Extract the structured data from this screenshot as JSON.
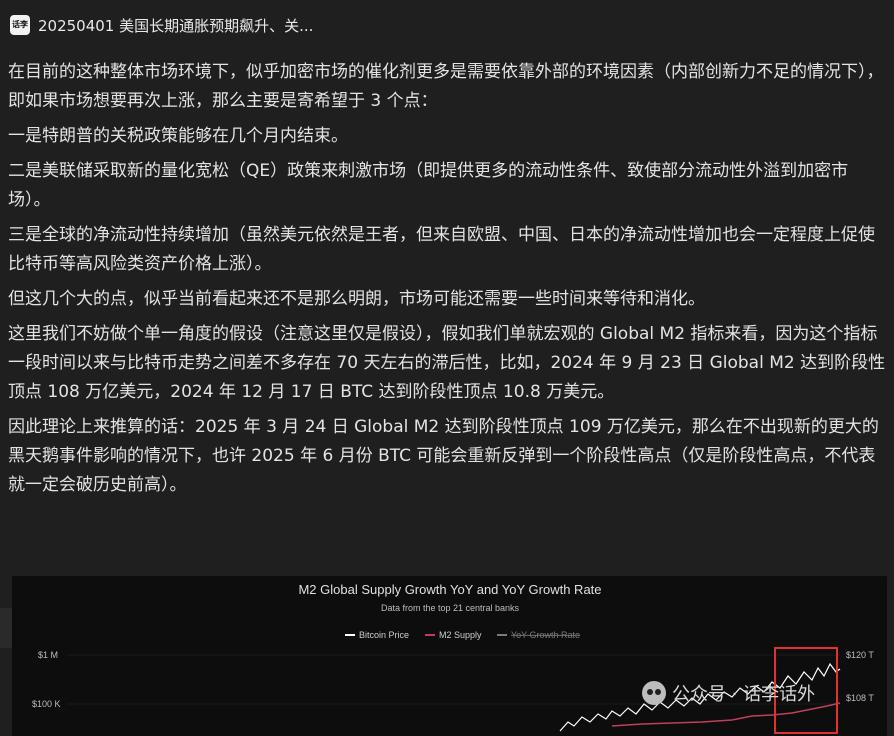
{
  "header": {
    "avatar_text": "话李",
    "title": "20250401 美国长期通胀预期飙升、关..."
  },
  "article": {
    "paragraphs": [
      "在目前的这种整体市场环境下，似乎加密市场的催化剂更多是需要依靠外部的环境因素（内部创新力不足的情况下），即如果市场想要再次上涨，那么主要是寄希望于 3 个点：",
      "一是特朗普的关税政策能够在几个月内结束。",
      "二是美联储采取新的量化宽松（QE）政策来刺激市场（即提供更多的流动性条件、致使部分流动性外溢到加密市场）。",
      "三是全球的净流动性持续增加（虽然美元依然是王者，但来自欧盟、中国、日本的净流动性增加也会一定程度上促使比特币等高风险类资产价格上涨）。",
      "但这几个大的点，似乎当前看起来还不是那么明朗，市场可能还需要一些时间来等待和消化。",
      "这里我们不妨做个单一角度的假设（注意这里仅是假设），假如我们单就宏观的 Global M2 指标来看，因为这个指标一段时间以来与比特币走势之间差不多存在 70 天左右的滞后性，比如，2024 年 9 月 23 日 Global M2 达到阶段性顶点 108 万亿美元，2024 年 12 月 17 日 BTC 达到阶段性顶点 10.8 万美元。",
      "因此理论上来推算的话：2025 年 3 月 24 日 Global M2 达到阶段性顶点 109 万亿美元，那么在不出现新的更大的黑天鹅事件影响的情况下，也许 2025 年 6 月份 BTC 可能会重新反弹到一个阶段性高点（仅是阶段性高点，不代表就一定会破历史前高）。"
    ]
  },
  "chart": {
    "title": "M2 Global Supply Growth YoY and YoY Growth Rate",
    "subtitle": "Data from the top 21 central banks",
    "legend": [
      "Bitcoin Price",
      "M2 Supply",
      "YoY Growth Rate"
    ],
    "left_axis": [
      "$1 M",
      "$100 K"
    ],
    "right_axis": [
      "$120 T",
      "$108 T"
    ],
    "colors": {
      "btc": "#ffffff",
      "m2": "#c0405a",
      "yoy": "#7a7a7a",
      "highlight": "#e03030"
    }
  },
  "watermark": {
    "text": "公众号 · 话李话外"
  }
}
